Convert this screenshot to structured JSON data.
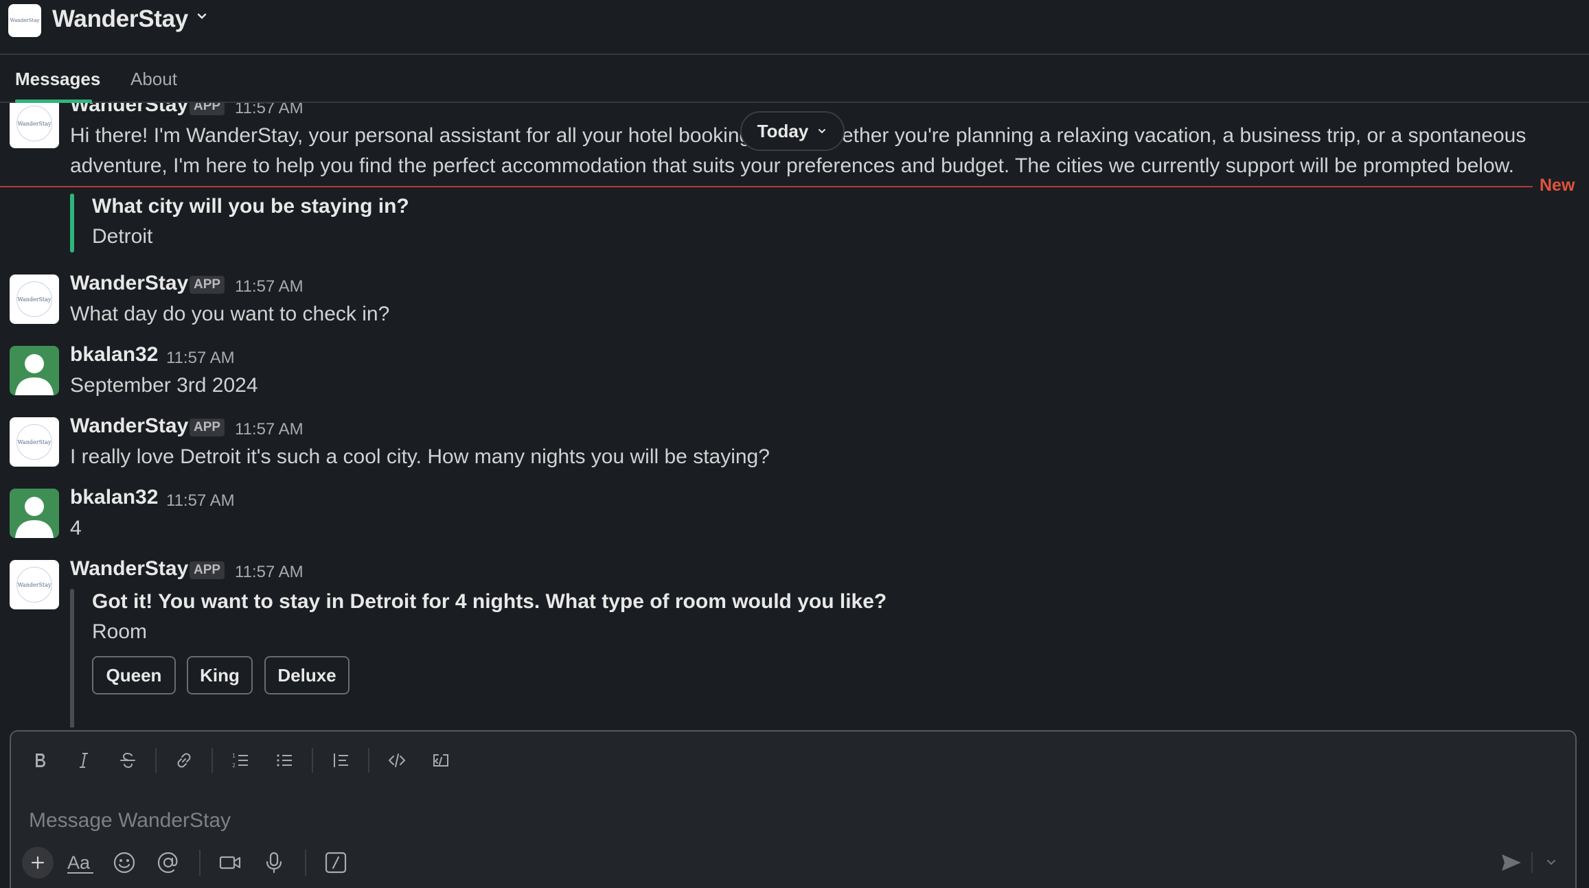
{
  "header": {
    "title": "WanderStay",
    "logo_text": "WanderStay"
  },
  "tabs": [
    {
      "label": "Messages",
      "active": true
    },
    {
      "label": "About",
      "active": false
    }
  ],
  "date_divider": {
    "label": "Today"
  },
  "new_marker": {
    "label": "New"
  },
  "messages": [
    {
      "sender": "WanderStay",
      "badge": "APP",
      "time": "11:57 AM",
      "lines": [
        "Hi there! I'm WanderStay, your personal assistant for all your hotel booking",
        "ether you're planning a relaxing vacation, a business trip, or a spontaneous",
        "adventure, I'm here to help you find the perfect accommodation that suits your preferences and budget. The cities we currently support will be prompted below."
      ],
      "quote": {
        "question": "What city will you be staying in?",
        "answer": "Detroit"
      }
    },
    {
      "sender": "WanderStay",
      "badge": "APP",
      "time": "11:57 AM",
      "text": "What day do you want to check in?"
    },
    {
      "sender": "bkalan32",
      "time": "11:57 AM",
      "text": "September 3rd 2024"
    },
    {
      "sender": "WanderStay",
      "badge": "APP",
      "time": "11:57 AM",
      "text": "I really love Detroit it's such a cool city. How many nights you will be staying?"
    },
    {
      "sender": "bkalan32",
      "time": "11:57 AM",
      "text": "4"
    },
    {
      "sender": "WanderStay",
      "badge": "APP",
      "time": "11:57 AM",
      "quote": {
        "question": "Got it! You want to stay in Detroit for 4 nights. What type of room would you like?",
        "answer": "Room"
      },
      "choices": [
        "Queen",
        "King",
        "Deluxe"
      ]
    }
  ],
  "composer": {
    "placeholder": "Message WanderStay"
  },
  "colors": {
    "background": "#1a1d21",
    "accent_green": "#2eb67d",
    "new_red": "#e0533b",
    "user_avatar": "#3f8f55"
  }
}
